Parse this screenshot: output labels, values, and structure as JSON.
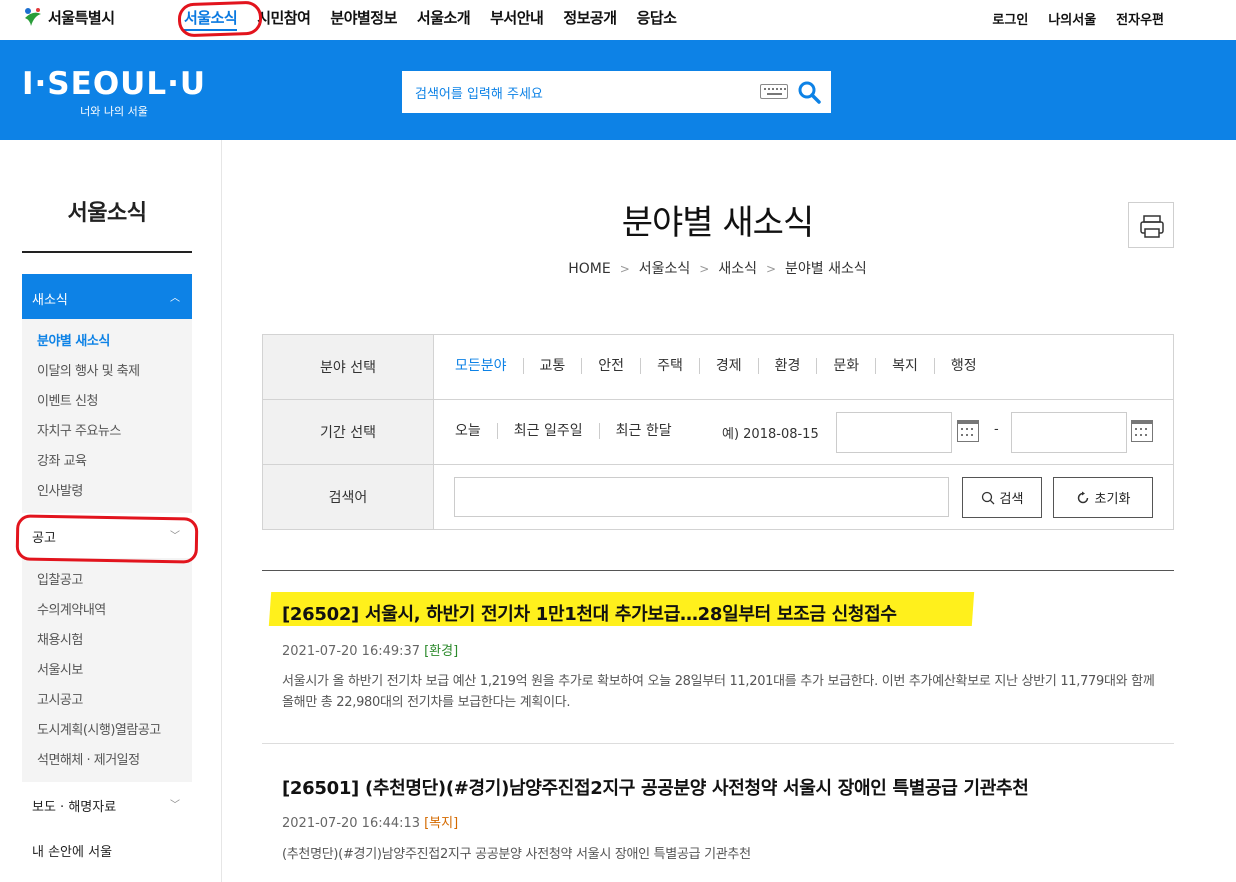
{
  "gnb": {
    "logo_text": "서울특별시",
    "menu": [
      "서울소식",
      "시민참여",
      "분야별정보",
      "서울소개",
      "부서안내",
      "정보공개",
      "응답소"
    ],
    "util": [
      "로그인",
      "나의서울",
      "전자우편"
    ]
  },
  "header": {
    "brand": "I·SEOUL·U",
    "brand_sub": "너와 나의 서울",
    "search_placeholder": "검색어를 입력해 주세요",
    "accent": "#0d82e6"
  },
  "sidebar": {
    "title": "서울소식",
    "group1": "새소식",
    "group1_items": [
      "분야별 새소식",
      "이달의 행사 및 축제",
      "이벤트 신청",
      "자치구 주요뉴스",
      "강좌 교육",
      "인사발령"
    ],
    "group2": "공고",
    "group2_items": [
      "입찰공고",
      "수의계약내역",
      "채용시험",
      "서울시보",
      "고시공고",
      "도시계획(시행)열람공고",
      "석면해체 · 제거일정"
    ],
    "group3": "보도 · 해명자료",
    "group4": "내 손안에 서울"
  },
  "page": {
    "title": "분야별 새소식",
    "breadcrumb": [
      "HOME",
      "서울소식",
      "새소식",
      "분야별 새소식"
    ]
  },
  "filter": {
    "category_label": "분야 선택",
    "categories": [
      "모든분야",
      "교통",
      "안전",
      "주택",
      "경제",
      "환경",
      "문화",
      "복지",
      "행정"
    ],
    "period_label": "기간 선택",
    "periods": [
      "오늘",
      "최근 일주일",
      "최근 한달"
    ],
    "date_example": "예) 2018-08-15",
    "date_sep": "-",
    "keyword_label": "검색어",
    "search_btn": "검색",
    "reset_btn": "초기화"
  },
  "articles": [
    {
      "title": "[26502] 서울시, 하반기 전기차 1만1천대 추가보급…28일부터 보조금 신청접수",
      "datetime": "2021-07-20 16:49:37",
      "category": "[환경]",
      "desc": "서울시가 올 하반기 전기차 보급 예산 1,219억 원을 추가로 확보하여 오늘 28일부터 11,201대를 추가 보급한다. 이번 추가예산확보로 지난 상반기 11,779대와 함께 올해만 총 22,980대의 전기차를 보급한다는 계획이다."
    },
    {
      "title": "[26501] (추천명단)(#경기)남양주진접2지구 공공분양 사전청약 서울시 장애인 특별공급 기관추천",
      "datetime": "2021-07-20 16:44:13",
      "category": "[복지]",
      "desc": "(추천명단)(#경기)남양주진접2지구 공공분양 사전청약 서울시 장애인 특별공급 기관추천"
    }
  ]
}
